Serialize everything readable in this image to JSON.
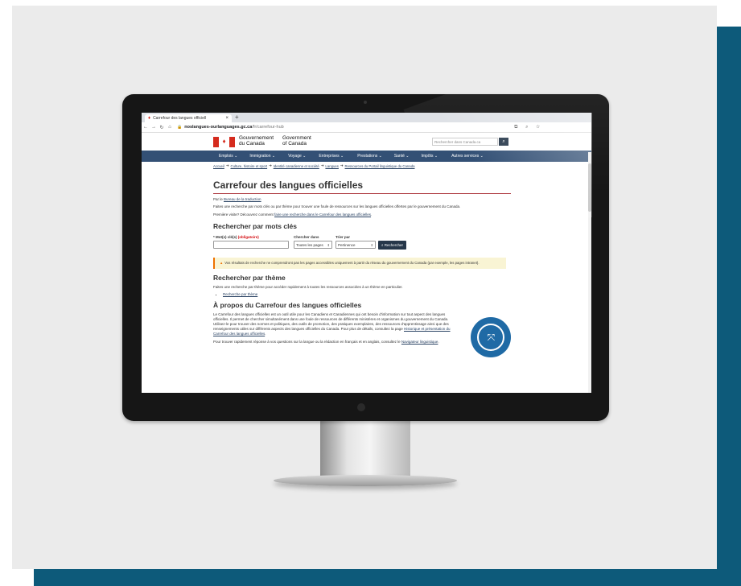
{
  "browser": {
    "tab_title": "Carrefour des langues officiell",
    "tab_close": "×",
    "new_tab": "+",
    "url_domain": "noslangues-ourlanguages.gc.ca",
    "url_path": "/fr/carrefour-hub"
  },
  "header": {
    "gov_fr_line1": "Gouvernement",
    "gov_fr_line2": "du Canada",
    "gov_en_line1": "Government",
    "gov_en_line2": "of Canada",
    "search_placeholder": "Rechercher dans Canada.ca"
  },
  "menu": [
    {
      "label": "Emplois ⌄"
    },
    {
      "label": "Immigration ⌄"
    },
    {
      "label": "Voyage ⌄"
    },
    {
      "label": "Entreprises ⌄"
    },
    {
      "label": "Prestations ⌄"
    },
    {
      "label": "Santé ⌄"
    },
    {
      "label": "Impôts ⌄"
    },
    {
      "label": "Autres services ⌄"
    }
  ],
  "breadcrumb": [
    {
      "label": "Accueil"
    },
    {
      "label": "Culture, histoire et sport"
    },
    {
      "label": "Identité canadienne et société"
    },
    {
      "label": "Langues"
    },
    {
      "label": "Ressources du Portail linguistique du Canada"
    }
  ],
  "content": {
    "title": "Carrefour des langues officielles",
    "byline_prefix": "Par le",
    "byline_link": "Bureau de la traduction",
    "intro": "Faites une recherche par mots clés ou par thème pour trouver une foule de ressources sur les langues officielles offertes par le gouvernement du Canada.",
    "first_visit_prefix": "Première visite? Découvrez comment",
    "first_visit_link": "faire une recherche dans le Carrefour des langues officielles",
    "keyword_heading": "Rechercher par mots clés",
    "keyword_label": "* Mot(s) clé(s)",
    "keyword_required": "(obligatoire)",
    "search_in_label": "Chercher dans",
    "search_in_value": "Toutes les pages",
    "sort_label": "Trier par",
    "sort_value": "Pertinence",
    "search_button": "Rechercher",
    "alert": "Vos résultats de recherche ne comprendront pas les pages accessibles uniquement à partir du réseau du gouvernement du Canada (par exemple, les pages intranet).",
    "theme_heading": "Rechercher par thème",
    "theme_text": "Faites une recherche par thème pour accéder rapidement à toutes les ressources associées à un thème en particulier.",
    "theme_link": "Recherche par thème",
    "about_heading": "À propos du Carrefour des langues officielles",
    "about_text": "Le Carrefour des langues officielles est un outil utile pour les Canadiens et Canadiennes qui ont besoin d'information sur tout aspect des langues officielles. Il permet de chercher simultanément dans une foule de ressources de différents ministères et organismes du gouvernement du Canada. Utilisez-le pour trouver des normes et politiques, des outils de promotion, des pratiques exemplaires, des ressources d'apprentissage ainsi que des renseignements utiles sur différents aspects des langues officielles du Canada. Pour plus de détails, consultez la page",
    "about_link": "Historique et présentation du Carrefour des langues officielles",
    "quick_prefix": "Pour trouver rapidement réponse à vos questions sur la langue ou la rédaction en français et en anglais, consultez le",
    "quick_link": "Navigateur linguistique"
  },
  "colors": {
    "teal_background": "#0d5a7a",
    "menu_bar": "#335075",
    "flag_red": "#d52b1e",
    "badge_blue": "#1f6aa5"
  }
}
